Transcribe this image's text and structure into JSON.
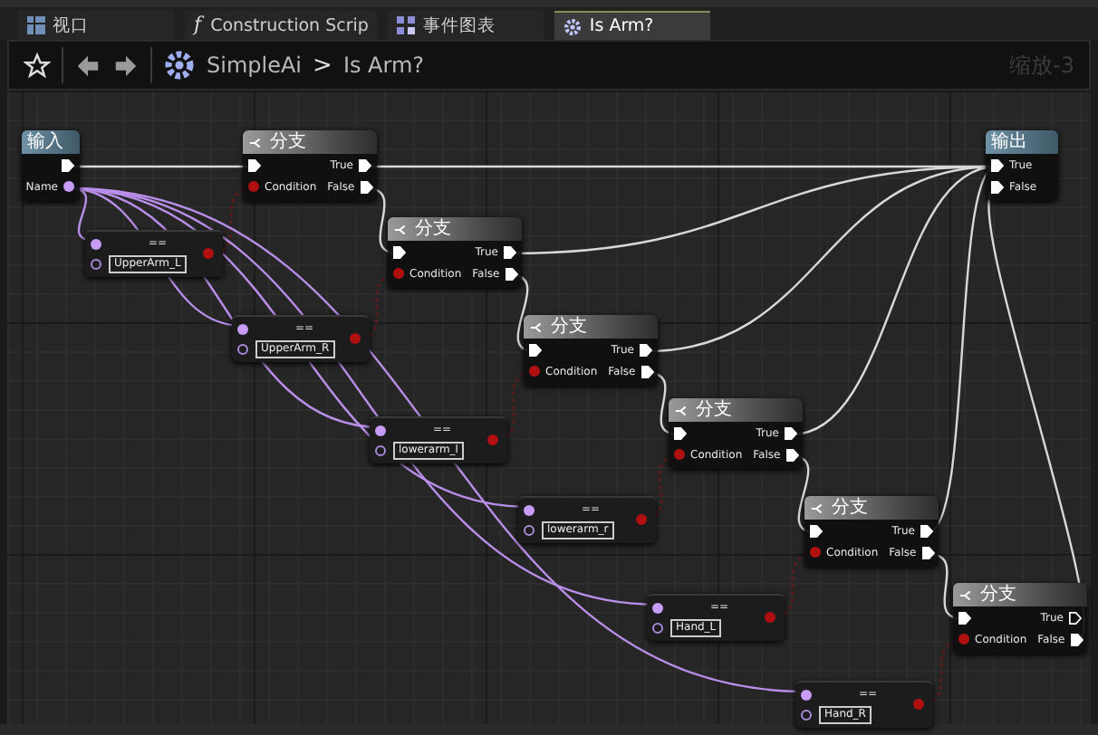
{
  "tabs": [
    {
      "kind": "viewport",
      "label": "视口",
      "selected": false
    },
    {
      "kind": "function",
      "glyph": "f",
      "label": "Construction Scrip",
      "selected": false
    },
    {
      "kind": "graph",
      "label": "事件图表",
      "selected": false
    },
    {
      "kind": "function-graph",
      "label": "Is Arm?",
      "selected": true
    }
  ],
  "breadcrumb": {
    "items": [
      "SimpleAi",
      "Is Arm?"
    ],
    "separator": ">"
  },
  "zoom": "缩放-3",
  "graph": {
    "entry": {
      "title": "输入",
      "pin": "Name"
    },
    "branches": [
      {
        "title": "分支",
        "condition": "Condition",
        "true": "True",
        "false": "False",
        "true_connected": true
      },
      {
        "title": "分支",
        "condition": "Condition",
        "true": "True",
        "false": "False",
        "true_connected": true
      },
      {
        "title": "分支",
        "condition": "Condition",
        "true": "True",
        "false": "False",
        "true_connected": true
      },
      {
        "title": "分支",
        "condition": "Condition",
        "true": "True",
        "false": "False",
        "true_connected": true
      },
      {
        "title": "分支",
        "condition": "Condition",
        "true": "True",
        "false": "False",
        "true_connected": true
      },
      {
        "title": "分支",
        "condition": "Condition",
        "true": "True",
        "false": "False",
        "true_connected": false
      }
    ],
    "compares": [
      {
        "title": "==",
        "value": "UpperArm_L"
      },
      {
        "title": "==",
        "value": "UpperArm_R"
      },
      {
        "title": "==",
        "value": "lowerarm_l"
      },
      {
        "title": "==",
        "value": "lowerarm_r"
      },
      {
        "title": "==",
        "value": "Hand_L"
      },
      {
        "title": "==",
        "value": "Hand_R"
      }
    ],
    "result": {
      "title": "输出",
      "pins": [
        "True",
        "False"
      ]
    }
  }
}
